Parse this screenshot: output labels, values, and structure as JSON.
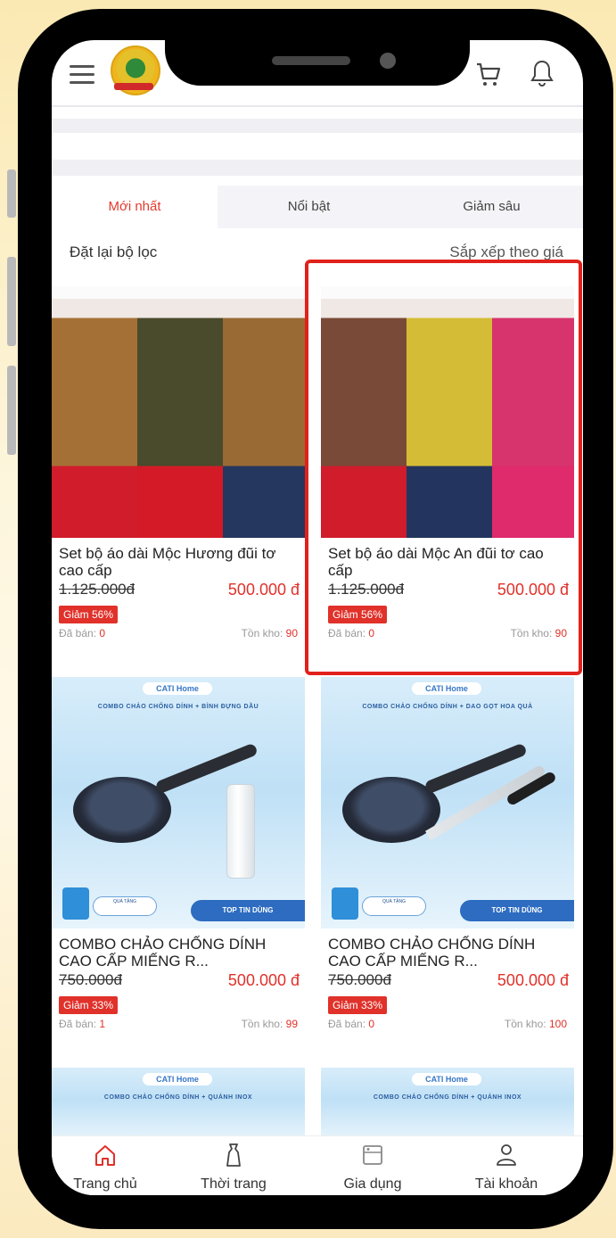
{
  "header": {
    "menu_icon": "hamburger-menu-icon",
    "logo": "union-logo",
    "cart_icon": "cart-icon",
    "bell_icon": "bell-icon"
  },
  "tabs": [
    {
      "label": "Mới nhất",
      "active": true
    },
    {
      "label": "Nổi bật",
      "active": false
    },
    {
      "label": "Giảm sâu",
      "active": false
    }
  ],
  "filter": {
    "reset_label": "Đặt lại bộ lọc",
    "sort_label": "Sắp xếp theo giá"
  },
  "products": [
    {
      "title": "Set bộ áo dài Mộc Hương đũi tơ cao cấp",
      "old_price": "1.125.000đ",
      "price": "500.000 đ",
      "discount": "Giảm 56%",
      "sold_label": "Đã bán:",
      "sold": "0",
      "stock_label": "Tồn kho:",
      "stock": "90"
    },
    {
      "title": "Set bộ áo dài Mộc An đũi tơ cao cấp",
      "old_price": "1.125.000đ",
      "price": "500.000 đ",
      "discount": "Giảm 56%",
      "sold_label": "Đã bán:",
      "sold": "0",
      "stock_label": "Tồn kho:",
      "stock": "90"
    },
    {
      "title": "COMBO CHẢO CHỐNG DÍNH CAO CẤP MIẾNG R...",
      "old_price": "750.000đ",
      "price": "500.000 đ",
      "discount": "Giảm 33%",
      "sold_label": "Đã bán:",
      "sold": "1",
      "stock_label": "Tồn kho:",
      "stock": "99",
      "brand": "CATI Home",
      "banner": "COMBO CHẢO CHỐNG DÍNH + BÌNH ĐỰNG DẦU",
      "gift": "QUÀ TẶNG",
      "badge": "TOP TIN DÙNG"
    },
    {
      "title": "COMBO CHẢO CHỐNG DÍNH CAO CẤP MIẾNG R...",
      "old_price": "750.000đ",
      "price": "500.000 đ",
      "discount": "Giảm 33%",
      "sold_label": "Đã bán:",
      "sold": "0",
      "stock_label": "Tồn kho:",
      "stock": "100",
      "brand": "CATI Home",
      "banner": "COMBO CHẢO CHỐNG DÍNH + DAO GỌT HOA QUẢ",
      "gift": "QUÀ TẶNG",
      "badge": "TOP TIN DÙNG"
    },
    {
      "brand": "CATI Home",
      "banner": "COMBO CHẢO CHỐNG DÍNH + QUÁNH INOX"
    },
    {
      "brand": "CATI Home",
      "banner": "COMBO CHẢO CHỐNG DÍNH + QUÁNH INOX"
    }
  ],
  "bottom_nav": [
    {
      "label": "Trang chủ",
      "icon": "home-icon",
      "active": true
    },
    {
      "label": "Thời trang",
      "icon": "dress-icon",
      "active": false
    },
    {
      "label": "Gia dụng",
      "icon": "appliance-icon",
      "active": false
    },
    {
      "label": "Tài khoản",
      "icon": "user-icon",
      "active": false
    }
  ],
  "colors": {
    "accent": "#e0312a",
    "highlight": "#e1211b",
    "tab_active": "#e23b2e"
  }
}
